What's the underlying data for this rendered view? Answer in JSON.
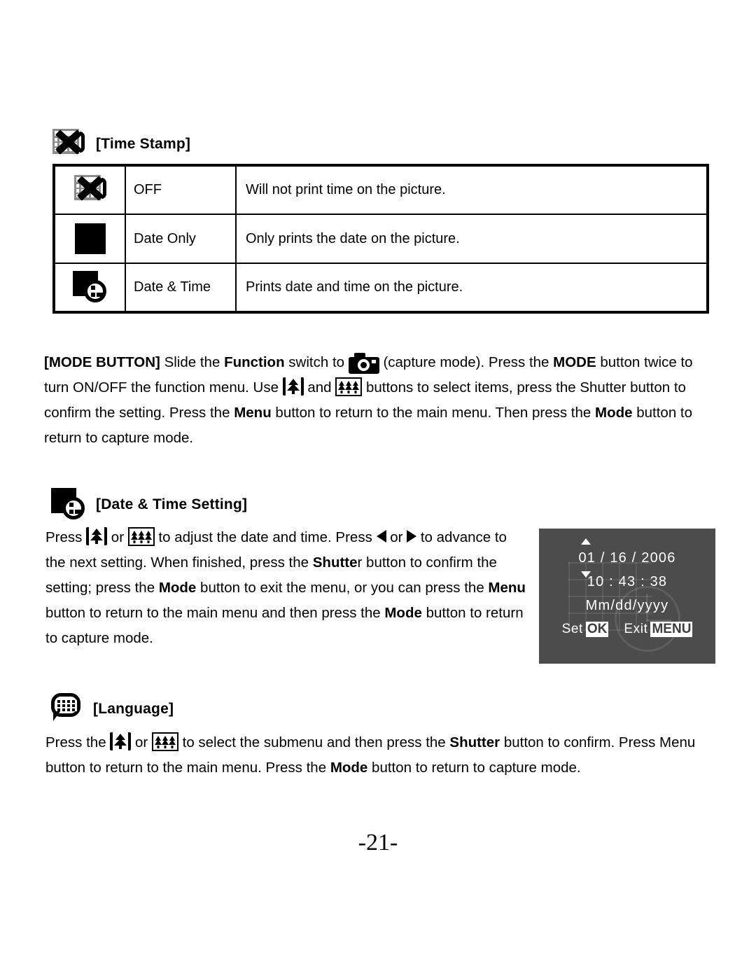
{
  "document": {
    "page_number": "-21-"
  },
  "time_stamp_section": {
    "icon": "calendar-crossed-out-icon",
    "heading": "[Time Stamp]",
    "table": {
      "rows": [
        {
          "icon": "calendar-crossed-out-icon",
          "name": "OFF",
          "description": "Will not print time on the picture."
        },
        {
          "icon": "calendar-grid-icon",
          "name": "Date Only",
          "description": "Only prints the date on the picture."
        },
        {
          "icon": "calendar-clock-icon",
          "name": "Date & Time",
          "description": "Prints date and time on the picture."
        }
      ]
    }
  },
  "mode_button_paragraph": {
    "lead": "[MODE BUTTON]",
    "t1": " Slide the ",
    "b1": "Function",
    "t2": " switch to ",
    "icon_camera": "camera-icon",
    "t3": " (capture mode). Press the ",
    "b2": "MODE",
    "t4": " button twice to turn ON/OFF the function menu. Use ",
    "icon_tele": "tele-button-icon",
    "t5": " and ",
    "icon_wide": "wide-button-icon",
    "t6": " buttons to select items, press the Shutter button to confirm the setting. Press the ",
    "b3": "Menu",
    "t7": " button to return to the main menu. Then press the ",
    "b4": "Mode",
    "t8": " button to return to capture mode."
  },
  "date_time_section": {
    "icon": "calendar-clock-icon",
    "heading": "[Date & Time Setting]",
    "p_t1": "Press ",
    "icon_tele": "tele-button-icon",
    "p_t2": " or ",
    "icon_wide": "wide-button-icon",
    "p_t3": " to adjust the date and time. Press ",
    "arrow_left": "arrow-left-icon",
    "p_t4": " or ",
    "arrow_right": "arrow-right-icon",
    "p_t5": " to advance to the next setting. When finished, press the ",
    "b1": "Shutte",
    "p_t6": "r button to confirm the setting; press the ",
    "b2": "Mode",
    "p_t7": " button to exit the menu, or you can press the ",
    "b3": "Menu",
    "p_t8": " button to return to the main menu and then press the ",
    "b4": "Mode",
    "p_t9": " button to return to capture mode."
  },
  "lcd_screen": {
    "date": "01 / 16 / 2006",
    "time": "10 : 43 : 38",
    "format": "Mm/dd/yyyy",
    "set_label": "Set",
    "set_key": "OK",
    "exit_label": "Exit",
    "exit_key": "MENU",
    "background_color": "#4c4c4c"
  },
  "language_section": {
    "icon": "speech-bubble-icon",
    "heading": "[Language]",
    "p_t1": "Press the ",
    "icon_tele": "tele-button-icon",
    "p_t2": " or ",
    "icon_wide": "wide-button-icon",
    "p_t3": " to select the submenu and then press the ",
    "b1": "Shutter",
    "p_t4": " button to confirm. Press Menu button to return to the main menu. Press the ",
    "b2": "Mode",
    "p_t5": " button to return to capture mode."
  }
}
